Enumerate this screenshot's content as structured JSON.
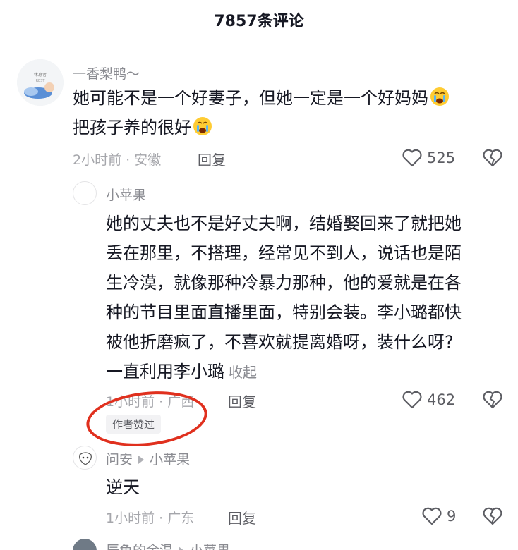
{
  "header": {
    "title": "7857条评论"
  },
  "comments": [
    {
      "username": "一香梨鸭～",
      "avatar_icon": "baby-sleeping-avatar",
      "avatar_text": "REST",
      "lines": [
        "她可能不是一个好妻子，但她一定是一个好妈妈",
        "把孩子养的很好"
      ],
      "emoji": "crying-face-emoji",
      "time": "2小时前 · 安徽",
      "reply_label": "回复",
      "likes": "525"
    },
    {
      "username": "小苹果",
      "lines": [
        "她的丈夫也不是好丈夫啊，结婚娶回来了就把她",
        "丢在那里，不搭理，经常见不到人，说话也是陌",
        "生冷漠，就像那种冷暴力那种，他的爱就是在各",
        "种的节目里面直播里面，特别会装。李小璐都快",
        "被他折磨疯了，不喜欢就提离婚呀，装什么呀?",
        "一直利用李小璐"
      ],
      "collapse_label": "收起",
      "time": "1小时前 · 广西",
      "reply_label": "回复",
      "likes": "462",
      "author_badge": "作者赞过"
    },
    {
      "username": "问安",
      "reply_to": "小苹果",
      "lines": [
        "逆天"
      ],
      "time": "1小时前 · 广东",
      "reply_label": "回复",
      "likes": "9"
    },
    {
      "username": "辰鱼的余温",
      "reply_to": "小苹果"
    }
  ],
  "colors": {
    "text": "#161823",
    "secondary": "#8a8b91",
    "highlight_circle": "#e0301e"
  }
}
